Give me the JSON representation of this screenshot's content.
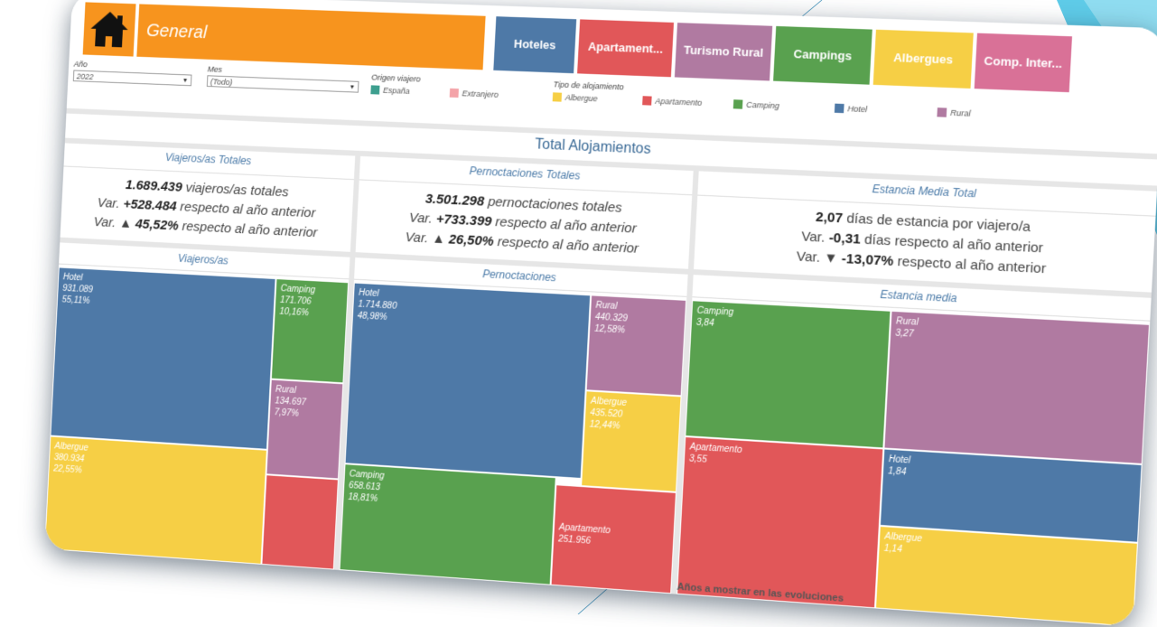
{
  "nav": {
    "title": "General",
    "tabs": [
      {
        "label": "Hoteles",
        "color": "#4e79a7"
      },
      {
        "label": "Apartament...",
        "color": "#e15759"
      },
      {
        "label": "Turismo Rural",
        "color": "#b07aa1"
      },
      {
        "label": "Campings",
        "color": "#59a14f"
      },
      {
        "label": "Albergues",
        "color": "#f6cf45"
      },
      {
        "label": "Comp. Inter...",
        "color": "#d97197"
      }
    ]
  },
  "filters": {
    "anio_label": "Año",
    "anio_value": "2022",
    "mes_label": "Mes",
    "mes_value": "(Todo)",
    "origen_label": "Origen viajero",
    "origen": [
      {
        "label": "España",
        "color": "#3d9f8f"
      },
      {
        "label": "Extranjero",
        "color": "#f4a3a8"
      }
    ],
    "tipo_label": "Tipo de alojamiento",
    "tipo": [
      {
        "label": "Albergue",
        "color": "#f6cf45"
      },
      {
        "label": "Apartamento",
        "color": "#e15759"
      },
      {
        "label": "Camping",
        "color": "#59a14f"
      },
      {
        "label": "Hotel",
        "color": "#4e79a7"
      },
      {
        "label": "Rural",
        "color": "#b07aa1"
      }
    ]
  },
  "main_title": "Total Alojamientos",
  "kpis": [
    {
      "header": "Viajeros/as Totales",
      "v1": "1.689.439",
      "t1": " viajeros/as totales",
      "v2pre": "Var. ",
      "v2": "+528.484",
      "t2": " respecto al año anterior",
      "v3pre": "Var. ▲ ",
      "v3": "45,52%",
      "t3": " respecto al año anterior"
    },
    {
      "header": "Pernoctaciones Totales",
      "v1": "3.501.298",
      "t1": " pernoctaciones totales",
      "v2pre": "Var. ",
      "v2": "+733.399",
      "t2": " respecto al año anterior",
      "v3pre": "Var. ▲ ",
      "v3": "26,50%",
      "t3": " respecto al año anterior"
    },
    {
      "header": "Estancia Media Total",
      "v1": "2,07",
      "t1": " días de estancia por viajero/a",
      "v2pre": "Var. ",
      "v2": "-0,31",
      "t2": " días respecto al año anterior",
      "v3pre": "Var. ▼ ",
      "v3": "-13,07%",
      "t3": " respecto al año anterior"
    }
  ],
  "treemaps": [
    {
      "header": "Viajeros/as",
      "cells": [
        {
          "name": "Hotel",
          "value": "931.089",
          "pct": "55,11%",
          "color": "#4e79a7"
        },
        {
          "name": "Camping",
          "value": "171.706",
          "pct": "10,16%",
          "color": "#59a14f"
        },
        {
          "name": "Rural",
          "value": "134.697",
          "pct": "7,97%",
          "color": "#b07aa1"
        },
        {
          "name": "Albergue",
          "value": "380.934",
          "pct": "22,55%",
          "color": "#f6cf45"
        },
        {
          "name": "",
          "value": "",
          "pct": "",
          "color": "#e15759"
        }
      ]
    },
    {
      "header": "Pernoctaciones",
      "cells": [
        {
          "name": "Hotel",
          "value": "1.714.880",
          "pct": "48,98%",
          "color": "#4e79a7"
        },
        {
          "name": "Rural",
          "value": "440.329",
          "pct": "12,58%",
          "color": "#b07aa1"
        },
        {
          "name": "Albergue",
          "value": "435.520",
          "pct": "12,44%",
          "color": "#f6cf45"
        },
        {
          "name": "Camping",
          "value": "658.613",
          "pct": "18,81%",
          "color": "#59a14f"
        },
        {
          "name": "Apartamento",
          "value": "251.956",
          "pct": "",
          "color": "#e15759"
        }
      ]
    },
    {
      "header": "Estancia media",
      "cells": [
        {
          "name": "Camping",
          "value": "3,84",
          "pct": "",
          "color": "#59a14f"
        },
        {
          "name": "Rural",
          "value": "3,27",
          "pct": "",
          "color": "#b07aa1"
        },
        {
          "name": "Apartamento",
          "value": "3,55",
          "pct": "",
          "color": "#e15759"
        },
        {
          "name": "Hotel",
          "value": "1,84",
          "pct": "",
          "color": "#4e79a7"
        },
        {
          "name": "Albergue",
          "value": "1,14",
          "pct": "",
          "color": "#f6cf45"
        }
      ]
    }
  ],
  "footer": "Años a mostrar en las evoluciones"
}
